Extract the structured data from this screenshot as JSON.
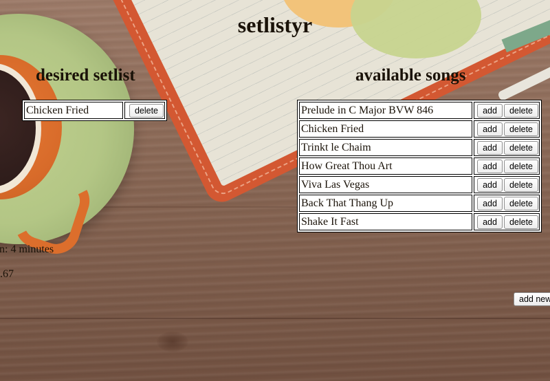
{
  "app": {
    "title": "setlistyr"
  },
  "desired": {
    "heading": "desired setlist",
    "songs": [
      {
        "title": "Chicken Fried",
        "delete_label": "delete"
      }
    ]
  },
  "available": {
    "heading": "available songs",
    "songs": [
      {
        "title": "Prelude in C Major BVW 846",
        "add_label": "add",
        "delete_label": "delete"
      },
      {
        "title": "Chicken Fried",
        "add_label": "add",
        "delete_label": "delete"
      },
      {
        "title": "Trinkt le Chaim",
        "add_label": "add",
        "delete_label": "delete"
      },
      {
        "title": "How Great Thou Art",
        "add_label": "add",
        "delete_label": "delete"
      },
      {
        "title": "Viva Las Vegas",
        "add_label": "add",
        "delete_label": "delete"
      },
      {
        "title": "Back That Thang Up",
        "add_label": "add",
        "delete_label": "delete"
      },
      {
        "title": "Shake It Fast",
        "add_label": "add",
        "delete_label": "delete"
      }
    ]
  },
  "stats": {
    "duration_text": "n: 4 minutes",
    "value_text": ".67"
  },
  "add_new": {
    "label": "add new"
  }
}
